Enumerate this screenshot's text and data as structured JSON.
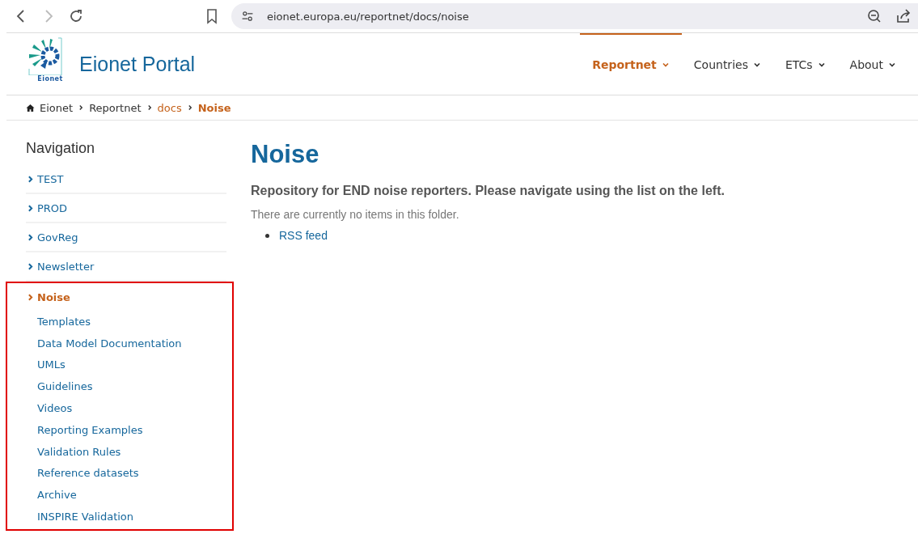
{
  "browser": {
    "url": "eionet.europa.eu/reportnet/docs/noise"
  },
  "header": {
    "logo_text": "Eionet",
    "title": "Eionet Portal",
    "menu": [
      {
        "label": "Reportnet",
        "selected": true
      },
      {
        "label": "Countries",
        "selected": false
      },
      {
        "label": "ETCs",
        "selected": false
      },
      {
        "label": "About",
        "selected": false
      }
    ]
  },
  "breadcrumb": [
    {
      "label": "Eionet",
      "kind": "home"
    },
    {
      "label": "Reportnet",
      "kind": "link"
    },
    {
      "label": "docs",
      "kind": "folder"
    },
    {
      "label": "Noise",
      "kind": "current"
    }
  ],
  "sidebar": {
    "title": "Navigation",
    "items": [
      {
        "label": "TEST",
        "selected": false,
        "highlighted": false
      },
      {
        "label": "PROD",
        "selected": false,
        "highlighted": false
      },
      {
        "label": "GovReg",
        "selected": false,
        "highlighted": false
      },
      {
        "label": "Newsletter",
        "selected": false,
        "highlighted": false
      },
      {
        "label": "Noise",
        "selected": true,
        "highlighted": true,
        "children": [
          {
            "label": "Templates"
          },
          {
            "label": "Data Model Documentation"
          },
          {
            "label": "UMLs"
          },
          {
            "label": "Guidelines"
          },
          {
            "label": "Videos"
          },
          {
            "label": "Reporting Examples"
          },
          {
            "label": "Validation Rules"
          },
          {
            "label": "Reference datasets"
          },
          {
            "label": "Archive"
          },
          {
            "label": "INSPIRE Validation"
          }
        ]
      }
    ]
  },
  "main": {
    "title": "Noise",
    "lead": "Repository for END noise reporters. Please navigate using the list on the left.",
    "note": "There are currently no items in this folder.",
    "links": [
      "RSS feed"
    ]
  }
}
